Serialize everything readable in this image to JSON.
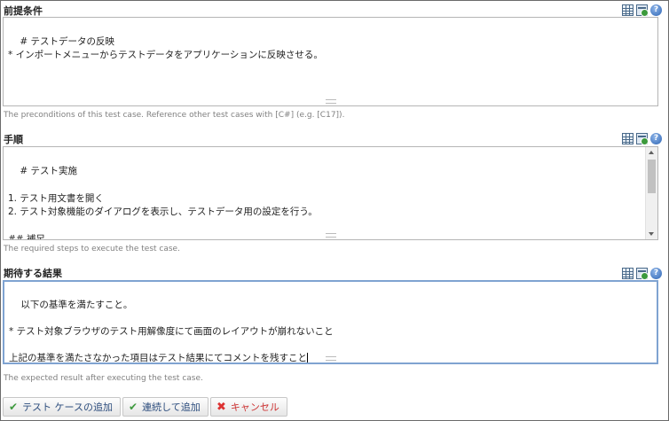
{
  "preconditions": {
    "label": "前提条件",
    "value": "# テストデータの反映\n* インポートメニューからテストデータをアプリケーションに反映させる。",
    "hint": "The preconditions of this test case. Reference other test cases with [C#] (e.g. [C17])."
  },
  "steps": {
    "label": "手順",
    "value": "# テスト実施\n\n1. テスト用文書を開く\n2. テスト対象機能のダイアログを表示し、テストデータ用の設定を行う。\n\n## 補足\n* 画面設定は以下を想定。",
    "hint": "The required steps to execute the test case."
  },
  "expected": {
    "label": "期待する結果",
    "value": "以下の基準を満たすこと。\n\n* テスト対象ブラウザのテスト用解像度にて画面のレイアウトが崩れないこと\n\n上記の基準を満たさなかった項目はテスト結果にてコメントを残すこと",
    "hint": "The expected result after executing the test case."
  },
  "toolbar_icons": [
    "table-icon",
    "insert-image-icon",
    "help-icon"
  ],
  "buttons": {
    "add": "テスト ケースの追加",
    "add_next": "連続して追加",
    "cancel": "キャンセル"
  },
  "colors": {
    "focus_border": "#7fa3d1",
    "button_text": "#2f4f7f",
    "cancel_red": "#cc3333",
    "check_green": "#3f9a3f"
  }
}
